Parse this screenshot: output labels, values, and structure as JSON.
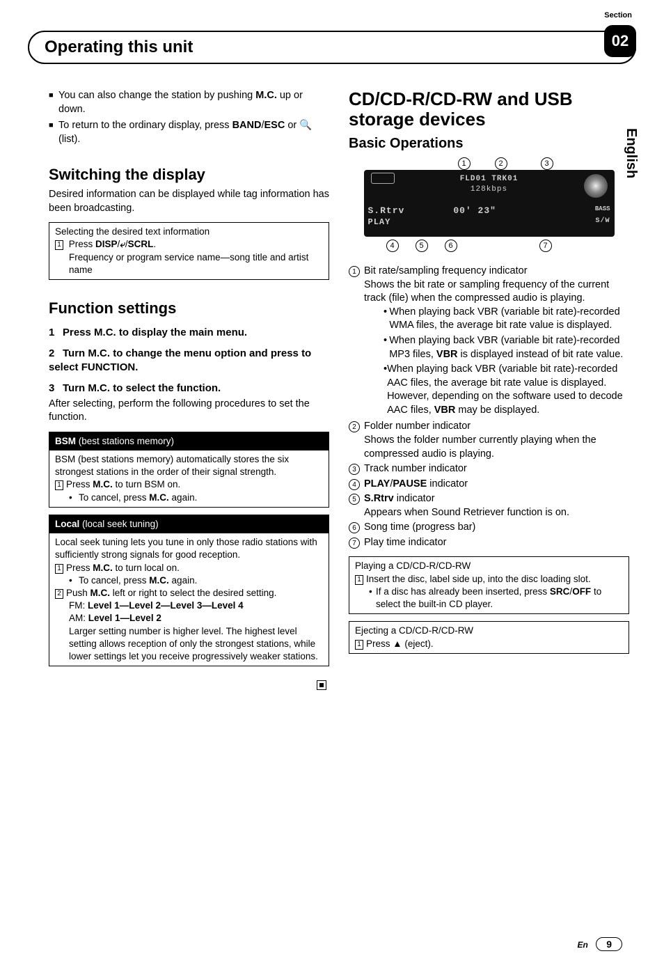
{
  "header": {
    "section_label": "Section",
    "section_number": "02",
    "title": "Operating this unit",
    "language_tab": "English"
  },
  "left": {
    "intro1_a": "You can also change the station by pushing ",
    "intro1_b": "M.C.",
    "intro1_c": " up or down.",
    "intro2_a": "To return to the ordinary display, press ",
    "intro2_b": "BAND",
    "intro2_c": "/",
    "intro2_d": "ESC",
    "intro2_e": " or ",
    "intro2_f": " (list).",
    "switching_title": "Switching the display",
    "switching_body": "Desired information can be displayed while tag information has been broadcasting.",
    "box1": {
      "head": "Selecting the desired text information",
      "step_num": "1",
      "step_a": "Press ",
      "step_b": "DISP",
      "step_c": "/",
      "step_d": "/",
      "step_e": "SCRL",
      "step_f": ".",
      "note": "Frequency or program service name—song title and artist name"
    },
    "func_title": "Function settings",
    "step1": {
      "n": "1",
      "t": "Press M.C. to display the main menu."
    },
    "step2": {
      "n": "2",
      "t": "Turn M.C. to change the menu option and press to select FUNCTION."
    },
    "step3": {
      "n": "3",
      "t": "Turn M.C. to select the function."
    },
    "step3_body": "After selecting, perform the following procedures to set the function.",
    "bsm": {
      "head_b": "BSM",
      "head_r": " (best stations memory)",
      "body": "BSM (best stations memory) automatically stores the six strongest stations in the order of their signal strength.",
      "s1_num": "1",
      "s1_a": "Press ",
      "s1_b": "M.C.",
      "s1_c": " to turn BSM on.",
      "s1_cancel_a": "To cancel, press ",
      "s1_cancel_b": "M.C.",
      "s1_cancel_c": " again."
    },
    "local": {
      "head_b": "Local",
      "head_r": " (local seek tuning)",
      "body": "Local seek tuning lets you tune in only those radio stations with sufficiently strong signals for good reception.",
      "s1_num": "1",
      "s1_a": "Press ",
      "s1_b": "M.C.",
      "s1_c": " to turn local on.",
      "s1_cancel_a": "To cancel, press ",
      "s1_cancel_b": "M.C.",
      "s1_cancel_c": " again.",
      "s2_num": "2",
      "s2_a": "Push ",
      "s2_b": "M.C.",
      "s2_c": " left or right to select the desired setting.",
      "fm_a": "FM: ",
      "fm_b": "Level 1—Level 2—Level 3—Level 4",
      "am_a": "AM: ",
      "am_b": "Level 1—Level 2",
      "tail": "Larger setting number is higher level. The highest level setting allows reception of only the strongest stations, while lower settings let you receive progressively weaker stations."
    }
  },
  "right": {
    "title": "CD/CD-R/CD-RW and USB storage devices",
    "subtitle": "Basic Operations",
    "screen": {
      "row1": "FLD01 TRK01",
      "row2": "128kbps",
      "srtrv": "S.Rtrv",
      "time": "00' 23\"",
      "bass": "BASS",
      "play": "PLAY",
      "sw": "S/W"
    },
    "call": {
      "c1": "1",
      "c2": "2",
      "c3": "3",
      "c4": "4",
      "c5": "5",
      "c6": "6",
      "c7": "7"
    },
    "item1": {
      "n": "1",
      "t": "Bit rate/sampling frequency indicator",
      "body": "Shows the bit rate or sampling frequency of the current track (file) when the compressed audio is playing.",
      "b1": "When playing back VBR (variable bit rate)-recorded WMA files, the average bit rate value is displayed.",
      "b2_a": "When playing back VBR (variable bit rate)-recorded MP3 files, ",
      "b2_b": "VBR",
      "b2_c": " is displayed instead of bit rate value.",
      "b3_a": "When playing back VBR (variable bit rate)-recorded AAC files, the average bit rate value is displayed. However, depending on the software used to decode AAC files, ",
      "b3_b": "VBR",
      "b3_c": " may be displayed."
    },
    "item2": {
      "n": "2",
      "t": "Folder number indicator",
      "body": "Shows the folder number currently playing when the compressed audio is playing."
    },
    "item3": {
      "n": "3",
      "t": "Track number indicator"
    },
    "item4": {
      "n": "4",
      "t_a": "PLAY",
      "t_b": "/",
      "t_c": "PAUSE",
      "t_d": " indicator"
    },
    "item5": {
      "n": "5",
      "t_a": "S.Rtrv",
      "t_b": " indicator",
      "body": "Appears when Sound Retriever function is on."
    },
    "item6": {
      "n": "6",
      "t": "Song time (progress bar)"
    },
    "item7": {
      "n": "7",
      "t": "Play time indicator"
    },
    "boxA": {
      "head": "Playing a CD/CD-R/CD-RW",
      "s1_num": "1",
      "s1": "Insert the disc, label side up, into the disc loading slot.",
      "b_a": "If a disc has already been inserted, press ",
      "b_b": "SRC",
      "b_c": "/",
      "b_d": "OFF",
      "b_e": " to select the built-in CD player."
    },
    "boxB": {
      "head": "Ejecting a CD/CD-R/CD-RW",
      "s1_num": "1",
      "s1_a": "Press ",
      "s1_b": " (eject)."
    }
  },
  "footer": {
    "lang": "En",
    "page": "9"
  }
}
